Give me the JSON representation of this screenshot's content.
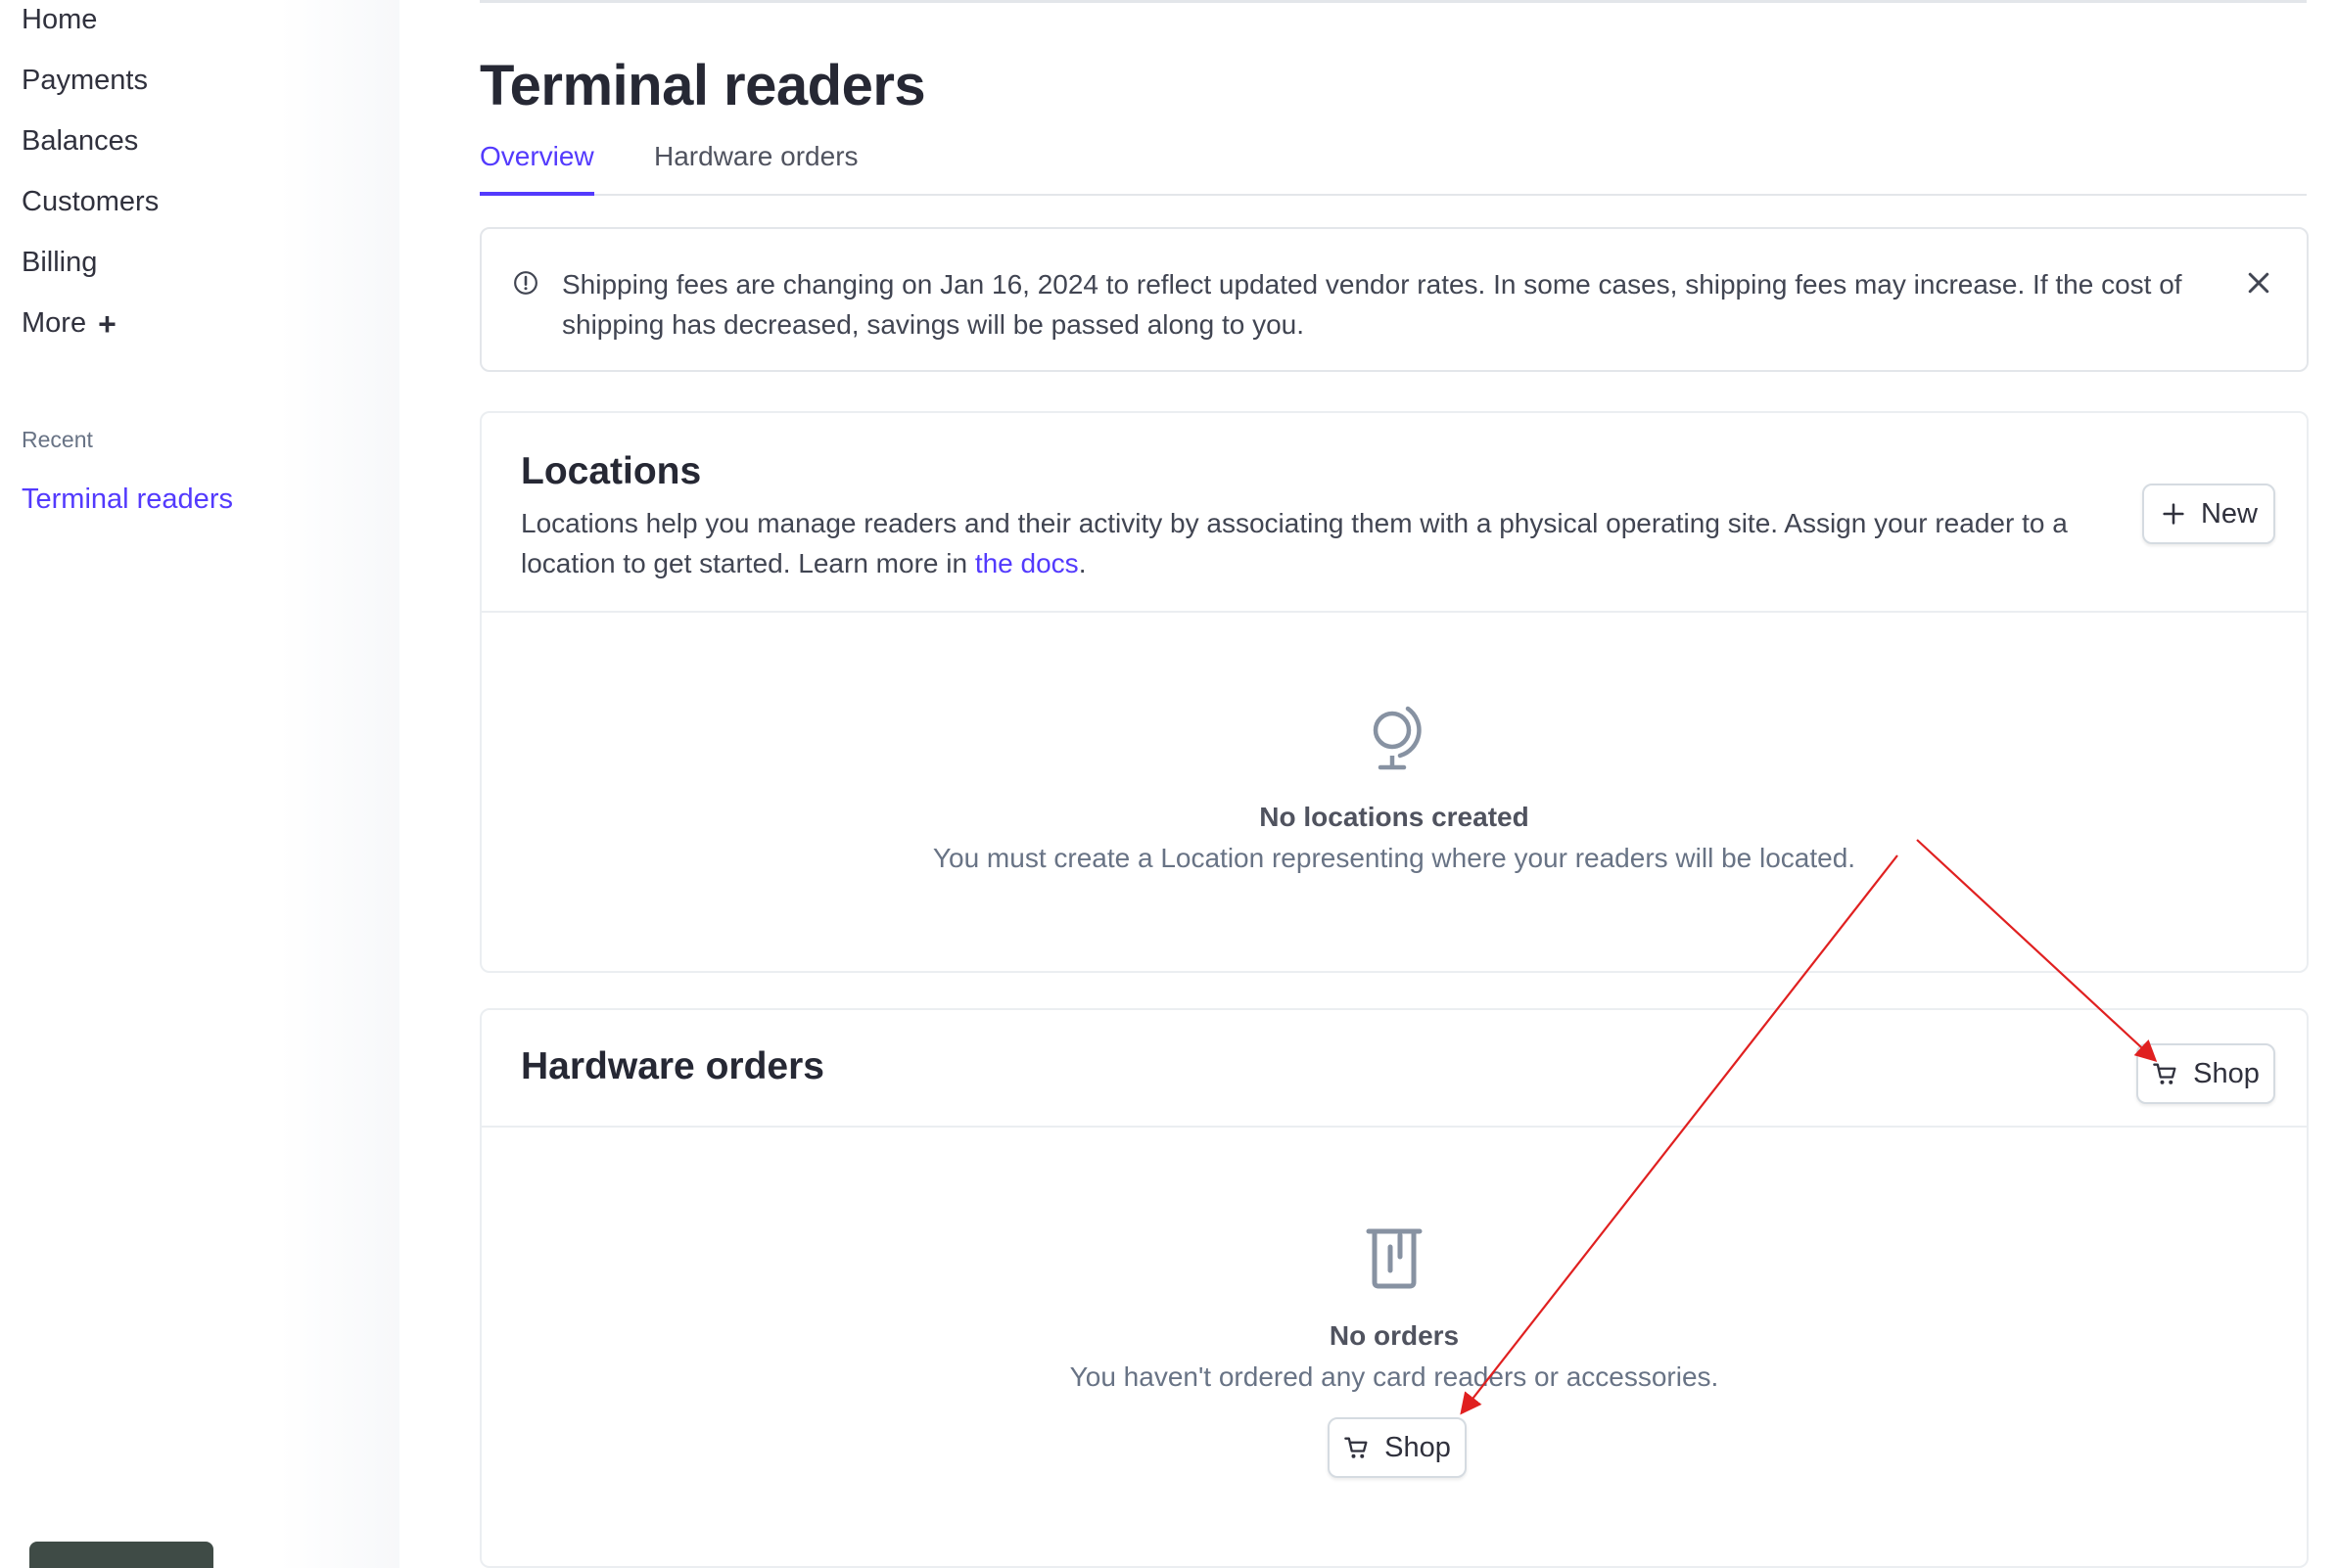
{
  "sidebar": {
    "nav": [
      "Home",
      "Payments",
      "Balances",
      "Customers",
      "Billing"
    ],
    "more_label": "More",
    "recent_label": "Recent",
    "recent_items": [
      "Terminal readers"
    ]
  },
  "page": {
    "title": "Terminal readers",
    "tabs": [
      {
        "label": "Overview",
        "active": true
      },
      {
        "label": "Hardware orders",
        "active": false
      }
    ]
  },
  "banner": {
    "icon": "info-icon",
    "message": "Shipping fees are changing on Jan 16, 2024 to reflect updated vendor rates. In some cases, shipping fees may increase. If the cost of shipping has decreased, savings will be passed along to you."
  },
  "locations": {
    "title": "Locations",
    "description_prefix": "Locations help you manage readers and their activity by associating them with a physical operating site. Assign your reader to a location to get started. Learn more in ",
    "docs_link": "the docs",
    "description_suffix": ".",
    "new_button": "New",
    "empty_icon": "globe-icon",
    "empty_title": "No locations created",
    "empty_desc": "You must create a Location representing where your readers will be located."
  },
  "hardware": {
    "title": "Hardware orders",
    "shop_button": "Shop",
    "empty_icon": "card-reader-icon",
    "empty_title": "No orders",
    "empty_desc": "You haven't ordered any card readers or accessories.",
    "empty_shop_button": "Shop"
  },
  "colors": {
    "accent": "#533afd",
    "annotation_arrow": "#e02020"
  }
}
